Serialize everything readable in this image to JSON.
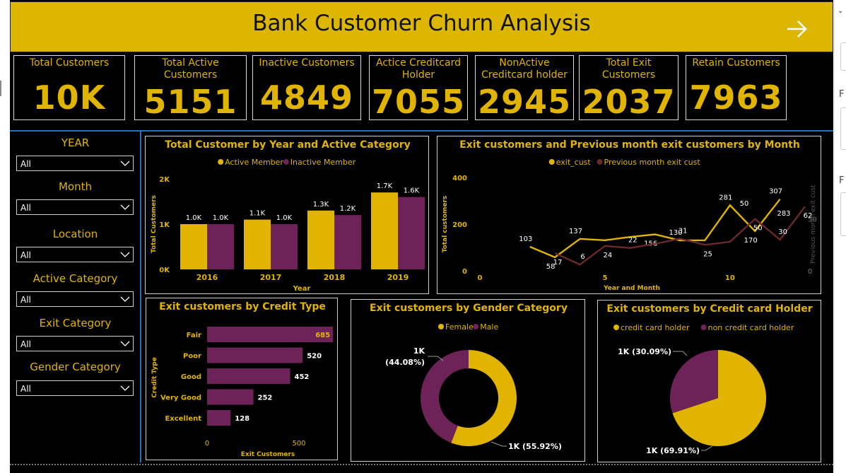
{
  "header": {
    "title": "Bank Customer Churn Analysis",
    "nav_icon": "arrow-right-icon"
  },
  "kpis": [
    {
      "label": "Total Customers",
      "value": "10K"
    },
    {
      "label": "Total Active Customers",
      "value": "5151"
    },
    {
      "label": "Inactive Customers",
      "value": "4849"
    },
    {
      "label": "Actice Creditcard Holder",
      "value": "7055"
    },
    {
      "label": "NonActive Creditcard holder",
      "value": "2945"
    },
    {
      "label": "Total Exit Customers",
      "value": "2037"
    },
    {
      "label": "Retain Customers",
      "value": "7963"
    }
  ],
  "slicers": [
    {
      "title": "YEAR",
      "value": "All"
    },
    {
      "title": "Month",
      "value": "All"
    },
    {
      "title": "Location",
      "value": "All"
    },
    {
      "title": "Active Category",
      "value": "All"
    },
    {
      "title": "Exit Category",
      "value": "All"
    },
    {
      "title": "Gender Category",
      "value": "All"
    }
  ],
  "side_panel": {
    "letters": [
      "F",
      "F"
    ]
  },
  "colors": {
    "gold": "#e0b400",
    "purple": "#6e2358",
    "maroon": "#6b2a2a",
    "title_bar": "#dcb600"
  },
  "chart_data": [
    {
      "id": "year_active",
      "type": "bar",
      "title": "Total Customer by Year and Active Category",
      "xlabel": "Year",
      "ylabel": "Total Customers",
      "categories": [
        "2016",
        "2017",
        "2018",
        "2019"
      ],
      "series": [
        {
          "name": "Active Member",
          "values": [
            1000,
            1100,
            1300,
            1700
          ],
          "labels": [
            "1.0K",
            "1.1K",
            "1.3K",
            "1.7K"
          ],
          "color": "#e0b400"
        },
        {
          "name": "Inactive Member",
          "values": [
            1000,
            1000,
            1200,
            1600
          ],
          "labels": [
            "1.0K",
            "1.0K",
            "1.2K",
            "1.6K"
          ],
          "color": "#6e2358"
        }
      ],
      "ylim": [
        0,
        2000
      ],
      "yticks": [
        {
          "v": 0,
          "t": "0K"
        },
        {
          "v": 1000,
          "t": "1K"
        },
        {
          "v": 2000,
          "t": "2K"
        }
      ],
      "legend": "top"
    },
    {
      "id": "exit_month",
      "type": "line",
      "title": "Exit customers and Previous month exit customers by Month",
      "xlabel": "Year and Month",
      "ylabel": "Total customers",
      "y2label": "Previous month exit cust",
      "xlim": [
        0,
        13
      ],
      "xticks": [
        0,
        5,
        10
      ],
      "ylim": [
        0,
        400
      ],
      "yticks": [
        0,
        200,
        400
      ],
      "y2lim": [
        0,
        90
      ],
      "y2ticks": [
        0,
        50
      ],
      "series": [
        {
          "name": "exit_cust",
          "color": "#e0b400",
          "x": [
            2,
            3,
            4,
            5,
            6,
            7,
            8,
            9,
            10,
            11,
            12
          ],
          "y": [
            103,
            58,
            137,
            131,
            145,
            156,
            130,
            131,
            281,
            170,
            307
          ],
          "labels": [
            "103",
            "58",
            "137",
            "",
            "",
            "156",
            "130",
            "",
            "281",
            "170",
            "307"
          ]
        },
        {
          "name": "Previous month exit cust",
          "color": "#6b2a2a",
          "x": [
            3,
            4,
            5,
            6,
            7,
            8,
            9,
            10,
            11,
            12,
            13
          ],
          "y": [
            17,
            6,
            24,
            22,
            26,
            31,
            25,
            28,
            50,
            30,
            62
          ],
          "labels": [
            "17",
            "6",
            "24",
            "22",
            "",
            "31",
            "25",
            "",
            "50",
            "30",
            "62"
          ]
        }
      ],
      "extra_labels": [
        "283",
        "50"
      ],
      "legend": "top"
    },
    {
      "id": "credit_type",
      "type": "bar",
      "orientation": "horizontal",
      "title": "Exit customers by Credit Type",
      "xlabel": "Exit Customers",
      "ylabel": "Credit Type",
      "categories": [
        "Fair",
        "Poor",
        "Good",
        "Very Good",
        "Excellent"
      ],
      "values": [
        685,
        520,
        452,
        252,
        128
      ],
      "xlim": [
        0,
        700
      ],
      "xticks": [
        0,
        500
      ],
      "color": "#6e2358"
    },
    {
      "id": "gender",
      "type": "pie",
      "donut": true,
      "title": "Exit customers by Gender Category",
      "slices": [
        {
          "name": "Female",
          "value": 55.92,
          "label": "1K (55.92%)",
          "color": "#e0b400"
        },
        {
          "name": "Male",
          "value": 44.08,
          "label_line1": "1K",
          "label_line2": "(44.08%)",
          "color": "#6e2358"
        }
      ],
      "legend": "top"
    },
    {
      "id": "cc_holder",
      "type": "pie",
      "title": "Exit customers by Credit card Holder",
      "slices": [
        {
          "name": "credit card holder",
          "value": 69.91,
          "label": "1K (69.91%)",
          "color": "#e0b400"
        },
        {
          "name": "non credit card holder",
          "value": 30.09,
          "label": "1K (30.09%)",
          "color": "#6e2358"
        }
      ],
      "legend": "top"
    }
  ]
}
